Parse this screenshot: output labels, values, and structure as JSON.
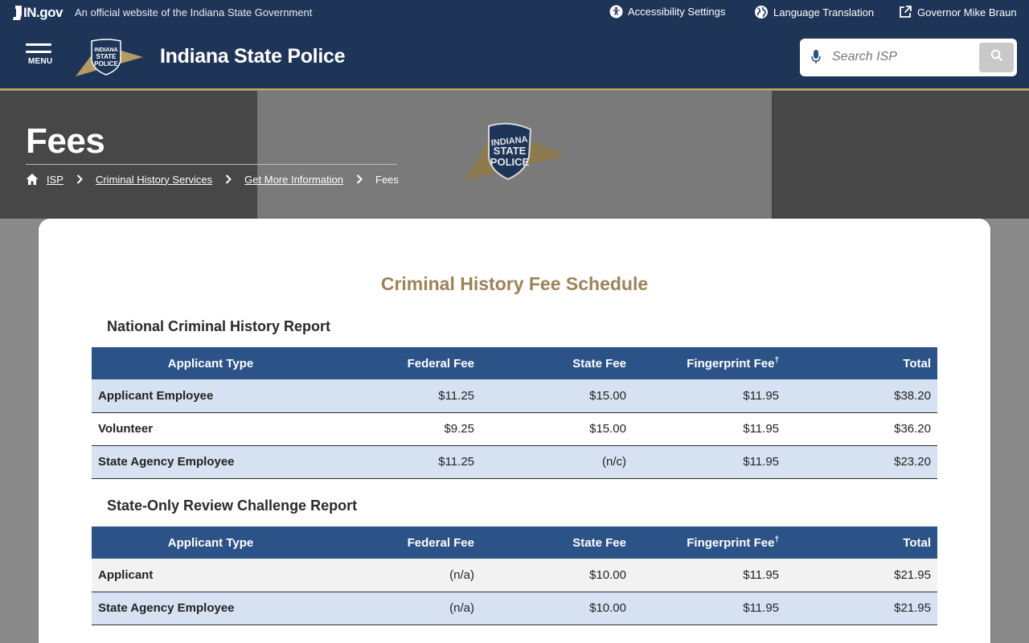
{
  "utility": {
    "brand": "IN.gov",
    "official_text": "An official website of the Indiana State Government",
    "accessibility_label": "Accessibility Settings",
    "translation_label": "Language Translation",
    "governor_label": "Governor Mike Braun"
  },
  "header": {
    "menu_label": "MENU",
    "logo_text": [
      "INDIANA",
      "STATE",
      "POLICE"
    ],
    "site_title": "Indiana State Police",
    "search_placeholder": "Search ISP"
  },
  "hero": {
    "page_title": "Fees",
    "breadcrumb": {
      "home": "ISP",
      "items": [
        "Criminal History Services",
        "Get More Information"
      ],
      "current": "Fees"
    }
  },
  "main": {
    "title": "Criminal History Fee Schedule",
    "sections": [
      {
        "heading": "National Criminal History Report",
        "columns": [
          "Applicant Type",
          "Federal Fee",
          "State Fee",
          "Fingerprint Fee",
          "Total"
        ],
        "footnote_mark": "†",
        "rows": [
          [
            "Applicant Employee",
            "$11.25",
            "$15.00",
            "$11.95",
            "$38.20"
          ],
          [
            "Volunteer",
            "$9.25",
            "$15.00",
            "$11.95",
            "$36.20"
          ],
          [
            "State Agency Employee",
            "$11.25",
            "(n/c)",
            "$11.95",
            "$23.20"
          ]
        ]
      },
      {
        "heading": "State-Only Review Challenge Report",
        "columns": [
          "Applicant Type",
          "Federal Fee",
          "State Fee",
          "Fingerprint Fee",
          "Total"
        ],
        "footnote_mark": "†",
        "rows": [
          [
            "Applicant",
            "(n/a)",
            "$10.00",
            "$11.95",
            "$21.95"
          ],
          [
            "State Agency Employee",
            "(n/a)",
            "$10.00",
            "$11.95",
            "$21.95"
          ]
        ]
      }
    ]
  },
  "colors": {
    "navy": "#1e3558",
    "gold": "#c8a95a",
    "table_header": "#2c5388",
    "row_shade": "#d6e2f2",
    "title_gold": "#9c8357"
  }
}
